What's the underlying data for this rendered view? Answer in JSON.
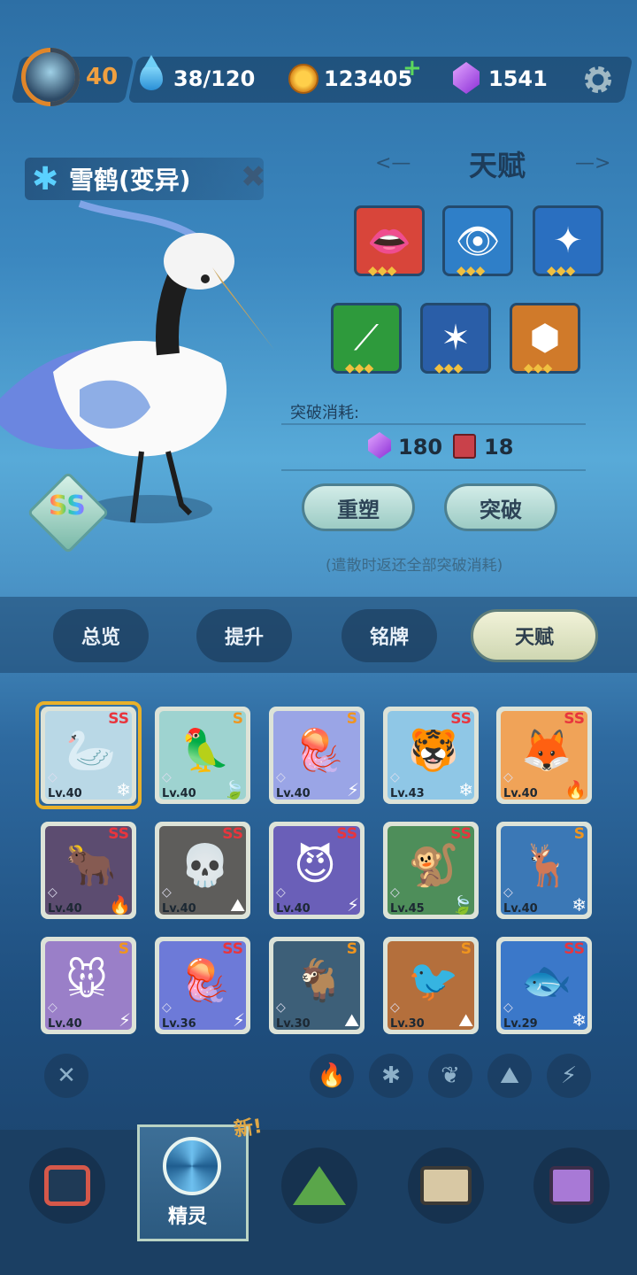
{
  "topbar": {
    "level": "40",
    "stamina": "38/120",
    "coins": "123405",
    "coin_add": "+",
    "gems": "1541"
  },
  "pet": {
    "name": "雪鹤(变异)",
    "grade": "SS"
  },
  "talent": {
    "title": "天赋",
    "deco_left": "<—",
    "deco_right": "—>",
    "icons": [
      {
        "name": "fang-talent-icon",
        "glyph": "👄",
        "bg": "#d8453a",
        "dots": "◆◆◆"
      },
      {
        "name": "eye-talent-icon",
        "glyph": "👁",
        "bg": "#2f7fc8",
        "dots": "◆◆◆"
      },
      {
        "name": "shuriken-talent-icon",
        "glyph": "✦",
        "bg": "#2a6fc0",
        "dots": "◆◆◆"
      },
      {
        "name": "claw-talent-icon",
        "glyph": "⟋",
        "bg": "#2e9a3c",
        "dots": "◆◆◆"
      },
      {
        "name": "spike-talent-icon",
        "glyph": "✶",
        "bg": "#2a5ea8",
        "dots": "◆◆◆"
      },
      {
        "name": "gem-talent-icon",
        "glyph": "⬢",
        "bg": "#d07a2a",
        "dots": "◆◆◆"
      }
    ],
    "breakthrough_cost_label": "突破消耗:",
    "gem_cost": "180",
    "book_cost": "18",
    "reshape_button": "重塑",
    "breakthrough_button": "突破",
    "note": "(遣散时返还全部突破消耗)"
  },
  "tabs": [
    "总览",
    "提升",
    "铭牌",
    "天赋"
  ],
  "active_tab": "天赋",
  "pets": [
    {
      "emoji": "🦢",
      "grade": "SS",
      "level": "Lv.40",
      "element": "❄",
      "bg": "#b9d8e6",
      "selected": true
    },
    {
      "emoji": "🦜",
      "grade": "S",
      "level": "Lv.40",
      "element": "🍃",
      "bg": "#9ed3d0"
    },
    {
      "emoji": "🪼",
      "grade": "S",
      "level": "Lv.40",
      "element": "⚡",
      "bg": "#9aa5e6"
    },
    {
      "emoji": "🐯",
      "grade": "SS",
      "level": "Lv.43",
      "element": "❄",
      "bg": "#8fc7e6"
    },
    {
      "emoji": "🦊",
      "grade": "SS",
      "level": "Lv.40",
      "element": "🔥",
      "bg": "#f0a358"
    },
    {
      "emoji": "🐂",
      "grade": "SS",
      "level": "Lv.40",
      "element": "🔥",
      "bg": "#5c4c70"
    },
    {
      "emoji": "💀",
      "grade": "SS",
      "level": "Lv.40",
      "element": "⛰",
      "bg": "#5e5d5b"
    },
    {
      "emoji": "😈",
      "grade": "SS",
      "level": "Lv.40",
      "element": "⚡",
      "bg": "#6a5fb8"
    },
    {
      "emoji": "🐒",
      "grade": "SS",
      "level": "Lv.45",
      "element": "🍃",
      "bg": "#4e8e5a"
    },
    {
      "emoji": "🦌",
      "grade": "S",
      "level": "Lv.40",
      "element": "❄",
      "bg": "#3b78b6"
    },
    {
      "emoji": "🐭",
      "grade": "S",
      "level": "Lv.40",
      "element": "⚡",
      "bg": "#9a7fc8"
    },
    {
      "emoji": "🪼",
      "grade": "SS",
      "level": "Lv.36",
      "element": "⚡",
      "bg": "#6d7ad8"
    },
    {
      "emoji": "🐐",
      "grade": "S",
      "level": "Lv.30",
      "element": "⛰",
      "bg": "#3d5f78"
    },
    {
      "emoji": "🐦",
      "grade": "S",
      "level": "Lv.30",
      "element": "⛰",
      "bg": "#b46f3c"
    },
    {
      "emoji": "🐟",
      "grade": "SS",
      "level": "Lv.29",
      "element": "❄",
      "bg": "#3b78c9"
    }
  ],
  "filters": {
    "clear": "✕",
    "fire": "🔥",
    "ice": "✱",
    "leaf": "❦",
    "earth": "⛰",
    "thunder": "⚡"
  },
  "nav": {
    "new_tag": "新!",
    "pets_label": "精灵"
  }
}
